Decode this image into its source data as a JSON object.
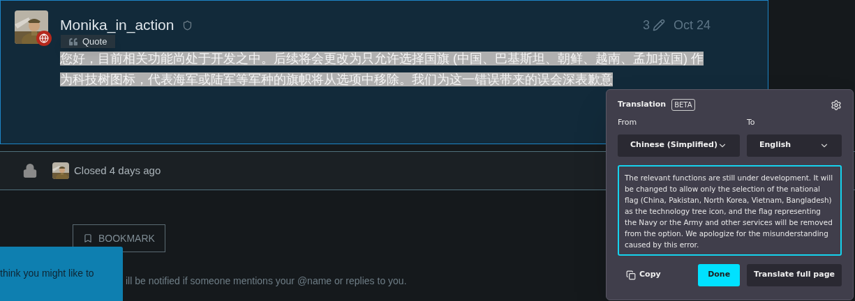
{
  "post": {
    "username": "Monika_in_action",
    "edit_count": "3",
    "date": "Oct 24",
    "body": "您好，目前相关功能尚处于开发之中。后续将会更改为只允许选择国旗 (中国、巴基斯坦、朝鲜、越南、孟加拉国) 作为科技树图标，代表海军或陆军等军种的旗帜将从选项中移除。我们为这一错误带来的误会深表歉意",
    "body_highlighted": true
  },
  "quote_tooltip": {
    "label": "Quote"
  },
  "closed_notice": {
    "text": "Closed 4 days ago"
  },
  "actions": [
    {
      "label": "BOOKMARK"
    }
  ],
  "notification_text": "ill be notified if someone mentions your @name or replies to you.",
  "popup": {
    "text": "think you might like to"
  },
  "translation": {
    "title": "Translation",
    "badge": "BETA",
    "from_label": "From",
    "to_label": "To",
    "from_value": "Chinese (Simplified)",
    "to_value": "English",
    "output": "The relevant functions are still under development. It will be changed to allow only the selection of the national flag (China, Pakistan, North Korea, Vietnam, Bangladesh) as the technology tree icon, and the flag representing the Navy or the Army and other services will be removed from the option. We apologize for the misunderstanding caused by this error.",
    "focused": true,
    "copy_label": "Copy",
    "done_label": "Done",
    "full_page_label": "Translate full page"
  }
}
